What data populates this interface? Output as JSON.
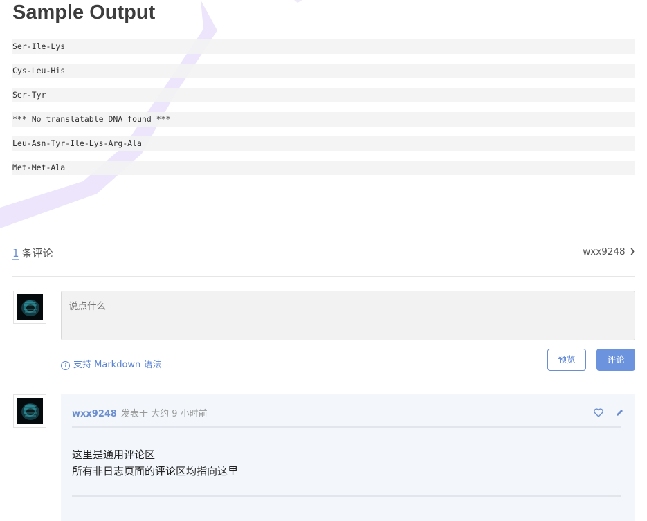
{
  "title": "Sample Output",
  "output_lines": [
    "Ser-Ile-Lys",
    "Cys-Leu-His",
    "Ser-Tyr",
    "*** No translatable DNA found ***",
    "Leu-Asn-Tyr-Ile-Lys-Arg-Ala",
    "Met-Met-Ala"
  ],
  "comments": {
    "count": "1",
    "count_label": "条评论",
    "current_user": "wxx9248",
    "input_placeholder": "说点什么",
    "markdown_hint": "支持 Markdown 语法",
    "preview_label": "预览",
    "submit_label": "评论",
    "items": [
      {
        "author": "wxx9248",
        "meta": "发表于  大约 9 小时前",
        "body_lines": [
          "这里是通用评论区",
          "所有非日志页面的评论区均指向这里"
        ]
      }
    ]
  },
  "colors": {
    "accent": "#6c8ecf",
    "submit_bg": "#6c94de",
    "code_bg": "#f2f2f2",
    "card_bg": "#f3f7fc"
  },
  "icons": [
    "info-icon",
    "chevron-down-icon",
    "heart-icon",
    "pencil-icon"
  ]
}
